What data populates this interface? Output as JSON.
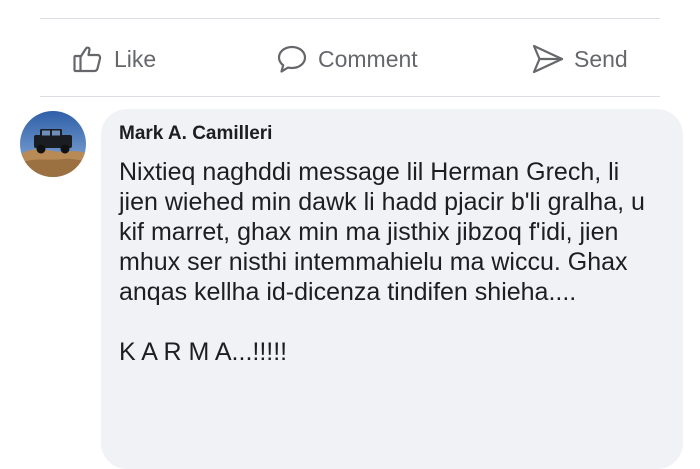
{
  "actions": {
    "like_label": "Like",
    "comment_label": "Comment",
    "send_label": "Send"
  },
  "comment": {
    "author": "Mark A. Camilleri",
    "text": "Nixtieq naghddi message lil Herman Grech, li jien wiehed min dawk li hadd pjacir b'li gralha, u kif marret, ghax min ma jisthix jibzoq f'idi, jien mhux ser nisthi intemmahielu ma wiccu. Ghax anqas kellha id-dicenza tindifen shieha....\n\nK A R M A...!!!!!",
    "avatar_icon": "car-avatar-icon"
  },
  "colors": {
    "bubble": "#f0f2f5",
    "muted_text": "#65676b",
    "divider": "#dadde1"
  }
}
